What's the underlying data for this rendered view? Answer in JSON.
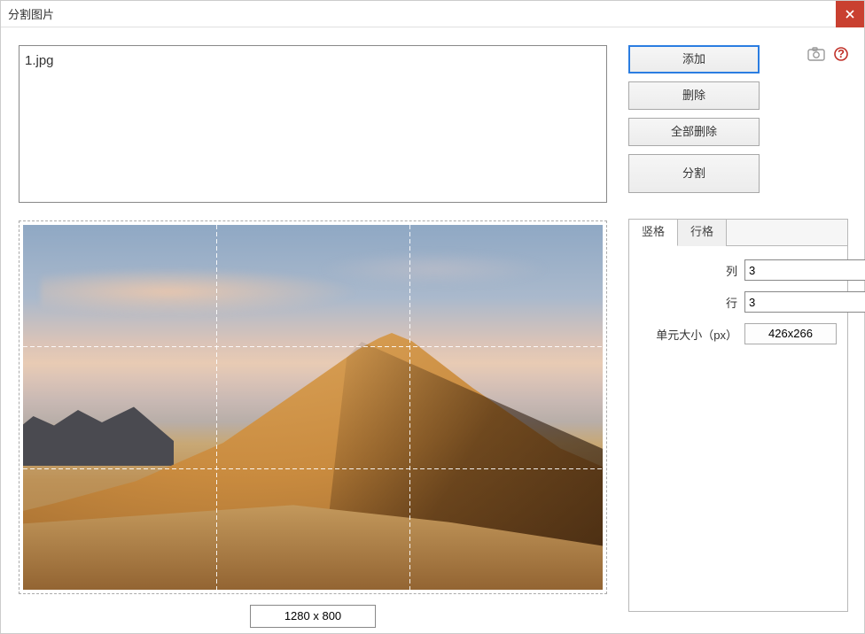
{
  "window": {
    "title": "分割图片"
  },
  "filelist": {
    "items": [
      "1.jpg"
    ]
  },
  "buttons": {
    "add": "添加",
    "remove": "删除",
    "remove_all": "全部删除",
    "split": "分割"
  },
  "preview": {
    "dimensions": "1280 x 800",
    "grid": {
      "cols": 3,
      "rows": 3
    }
  },
  "tabs": {
    "vertical": "竖格",
    "horizontal": "行格"
  },
  "form": {
    "cols_label": "列",
    "cols_value": "3",
    "rows_label": "行",
    "rows_value": "3",
    "cellsize_label": "单元大小（px）",
    "cellsize_value": "426x266"
  }
}
